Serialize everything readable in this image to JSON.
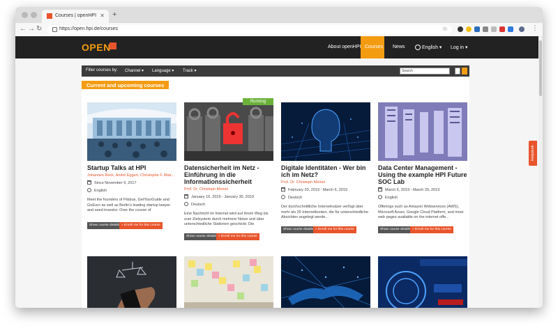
{
  "browser": {
    "tab_title": "Courses | openHPI",
    "url": "https://open.hpi.de/courses",
    "new_tab_icon": "plus-icon"
  },
  "site": {
    "logo_text": "OPEN",
    "nav": {
      "about": "About openHPI",
      "courses": "Courses",
      "news": "News",
      "language": "English",
      "login": "Log in"
    }
  },
  "filters": {
    "label": "Filter courses by:",
    "channel": "Channel",
    "language": "Language",
    "track": "Track",
    "search_placeholder": "Search"
  },
  "section_title": "Current and upcoming courses",
  "helpdesk": "Helpdesk",
  "buttons": {
    "show": "Show course details",
    "enroll": "Enroll me for this course"
  },
  "courses": [
    {
      "title": "Startup Talks at HPI",
      "teacher": "Johannes Reck, André Eggert, Christophe F. Mair...",
      "date": "Since November 9, 2017",
      "language": "English",
      "description": "Meet the founders of Flixbus, GetYourGuide and GoEuro as well as Berlin's leading startup lawyer and seed investor. Over the course of",
      "badge": ""
    },
    {
      "title": "Datensicherheit im Netz - Einführung in die Informationssicherheit",
      "teacher": "Prof. Dr. Christoph Meinel",
      "date": "January 16, 2019 - January 30, 2019",
      "language": "Deutsch",
      "description": "Eine Nachricht im Internet wird auf ihrem Weg bis zum Zielsystem durch mehrere Netze und über unterschiedliche Stationen geschickt. Die",
      "badge": "Running"
    },
    {
      "title": "Digitale Identitäten - Wer bin ich im Netz?",
      "teacher": "Prof. Dr. Christoph Meinel",
      "date": "February 20, 2019 - March 6, 2019",
      "language": "Deutsch",
      "description": "Der durchschnittliche Internetnutzer verfügt über mehr als 25 Internetkonten, die für unterschiedliche Absichten angelegt werde...",
      "badge": ""
    },
    {
      "title": "Data Center Management - Using the example HPI Future SOC Lab",
      "teacher": "",
      "date": "March 6, 2019 - March 20, 2019",
      "language": "English",
      "description": "Offerings such as Amazon Webservices (AWS), Microsoft Azure, Google Cloud Platform, and most web pages available on the internet offe...",
      "badge": ""
    }
  ],
  "second_row_images": [
    "phone-scale-image",
    "sticky-notes-image",
    "handshake-network-image",
    "password-protect-image"
  ],
  "colors": {
    "accent": "#f39c12",
    "enroll": "#e8542b",
    "navbar": "#222222",
    "running": "#6bb23b"
  }
}
